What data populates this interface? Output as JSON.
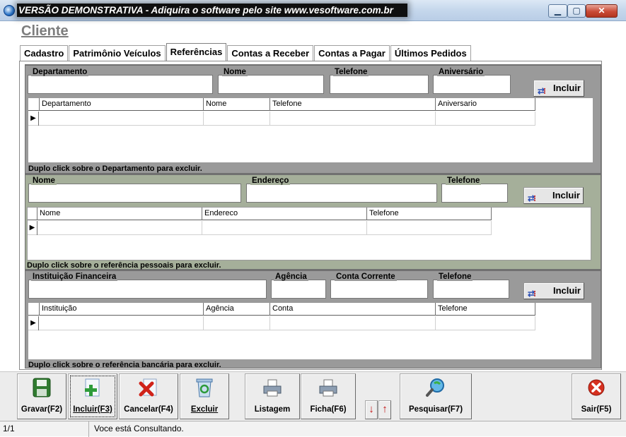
{
  "window": {
    "title": "VERSÃO DEMONSTRATIVA - Adiquira o software pelo site www.vesoftware.com.br",
    "min_label": "▁",
    "max_label": "▢",
    "close_label": "✕"
  },
  "page_title": "Cliente",
  "tabs": [
    {
      "label": "Cadastro"
    },
    {
      "label": "Patrimônio Veículos"
    },
    {
      "label": "Referências"
    },
    {
      "label": "Contas a Receber"
    },
    {
      "label": "Contas a Pagar"
    },
    {
      "label": "Últimos Pedidos"
    }
  ],
  "dept": {
    "fields": [
      "Departamento",
      "Nome",
      "Telefone",
      "Aniversário"
    ],
    "include_label": "Incluir",
    "columns": [
      "Departamento",
      "Nome",
      "Telefone",
      "Aniversario"
    ],
    "row_indicator": "▶",
    "hint": "Duplo click  sobre o Departamento para excluir."
  },
  "pessoal": {
    "fields": [
      "Nome",
      "Endereço",
      "Telefone"
    ],
    "include_label": "Incluir",
    "columns": [
      "Nome",
      "Endereco",
      "Telefone"
    ],
    "row_indicator": "▶",
    "hint": "Duplo click  sobre o referência pessoais para excluir."
  },
  "banco": {
    "fields": [
      "Instituição Financeira",
      "Agência",
      "Conta Corrente",
      "Telefone"
    ],
    "include_label": "Incluir",
    "columns": [
      "Instituição",
      "Agência",
      "Conta",
      "Telefone"
    ],
    "row_indicator": "▶",
    "hint": "Duplo click  sobre o referência bancária para excluir."
  },
  "toolbar": {
    "save": "Gravar(F2)",
    "include": "Incluir(F3)",
    "cancel": "Cancelar(F4)",
    "delete": "Excluir",
    "list": "Listagem",
    "card": "Ficha(F6)",
    "search": "Pesquisar(F7)",
    "exit": "Sair(F5)",
    "down_arrow": "↓",
    "up_arrow": "↑"
  },
  "status": {
    "record": "1/1",
    "message": "Voce está Consultando."
  },
  "colors": {
    "section_gray": "#9a9a9a",
    "section_green": "#a5af9a",
    "close_red": "#c94a36"
  },
  "icons": [
    "app-icon",
    "save-icon",
    "add-icon",
    "cancel-icon",
    "recycle-icon",
    "printer-icon",
    "search-icon",
    "exit-icon",
    "include-icon"
  ]
}
